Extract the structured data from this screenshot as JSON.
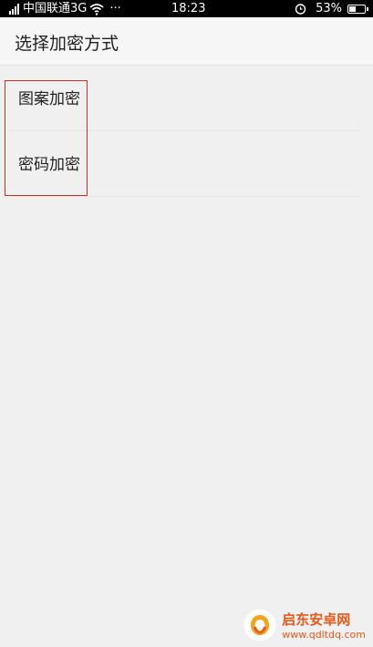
{
  "status_bar": {
    "carrier": "中国联通3G",
    "more": "···",
    "time": "18:23",
    "battery_percent": "53%",
    "battery_level": 0.53
  },
  "header": {
    "title": "选择加密方式"
  },
  "options": [
    {
      "label": "图案加密"
    },
    {
      "label": "密码加密"
    }
  ],
  "watermark": {
    "name": "启东安卓网",
    "url": "www.qdltdq.com"
  },
  "colors": {
    "highlight": "#c9302c",
    "watermark": "#e55a1b"
  }
}
